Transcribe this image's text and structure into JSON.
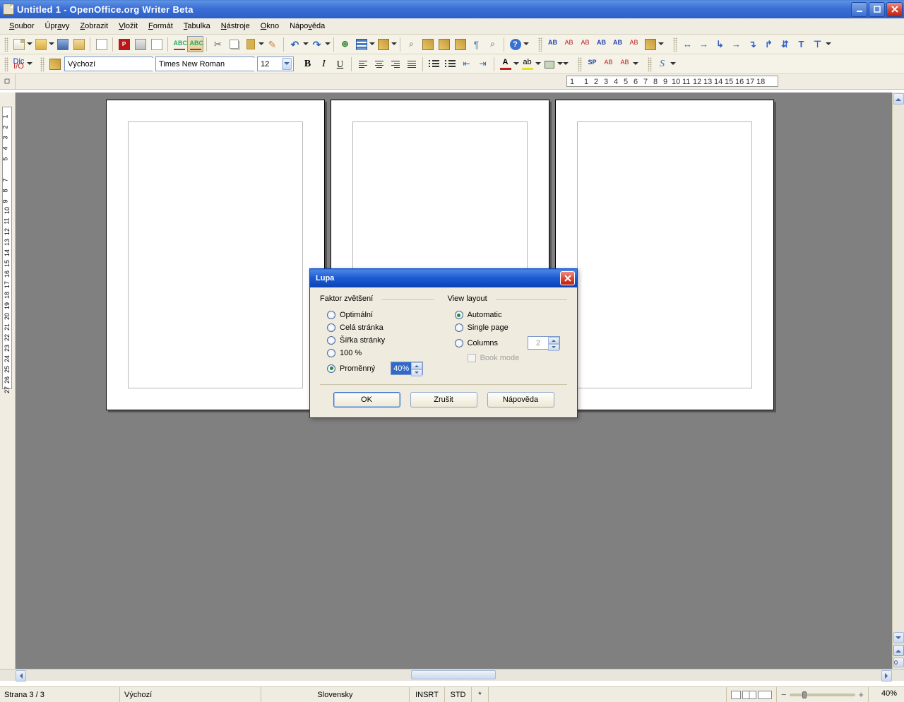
{
  "window": {
    "title": "Untitled 1 - OpenOffice.org Writer Beta"
  },
  "menu": {
    "file": "Soubor",
    "edit": "Úpravy",
    "view": "Zobrazit",
    "insert": "Vložit",
    "format": "Formát",
    "table": "Tabulka",
    "tools": "Nástroje",
    "window": "Okno",
    "help": "Nápověda"
  },
  "format_bar": {
    "style": "Výchozí",
    "font": "Times New Roman",
    "size": "12",
    "dic": "Dic",
    "io": "I/O"
  },
  "ruler": {
    "marks": [
      "1",
      "1",
      "2",
      "3",
      "4",
      "5",
      "6",
      "7",
      "8",
      "9",
      "10",
      "11",
      "12",
      "13",
      "14",
      "15",
      "16",
      "17",
      "18"
    ]
  },
  "vruler": {
    "marks": [
      "1",
      "2",
      "3",
      "4",
      "5",
      "7",
      "8",
      "9",
      "10",
      "11",
      "12",
      "13",
      "14",
      "15",
      "16",
      "17",
      "18",
      "19",
      "20",
      "21",
      "22",
      "23",
      "24",
      "25",
      "26",
      "27"
    ]
  },
  "status": {
    "page": "Strana 3 / 3",
    "style": "Výchozí",
    "lang": "Slovensky",
    "ins": "INSRT",
    "std": "STD",
    "mod": "*",
    "zoom": "40%"
  },
  "dialog": {
    "title": "Lupa",
    "left_legend": "Faktor zvětšení",
    "opt_optimal": "Optimální",
    "opt_wholepage": "Celá stránka",
    "opt_pagewidth": "Šířka stránky",
    "opt_100": "100 %",
    "opt_variable": "Proměnný",
    "variable_value": "40%",
    "right_legend": "View layout",
    "opt_auto": "Automatic",
    "opt_single": "Single page",
    "opt_columns": "Columns",
    "columns_value": "2",
    "opt_book": "Book mode",
    "btn_ok": "OK",
    "btn_cancel": "Zrušit",
    "btn_help": "Nápověda"
  }
}
